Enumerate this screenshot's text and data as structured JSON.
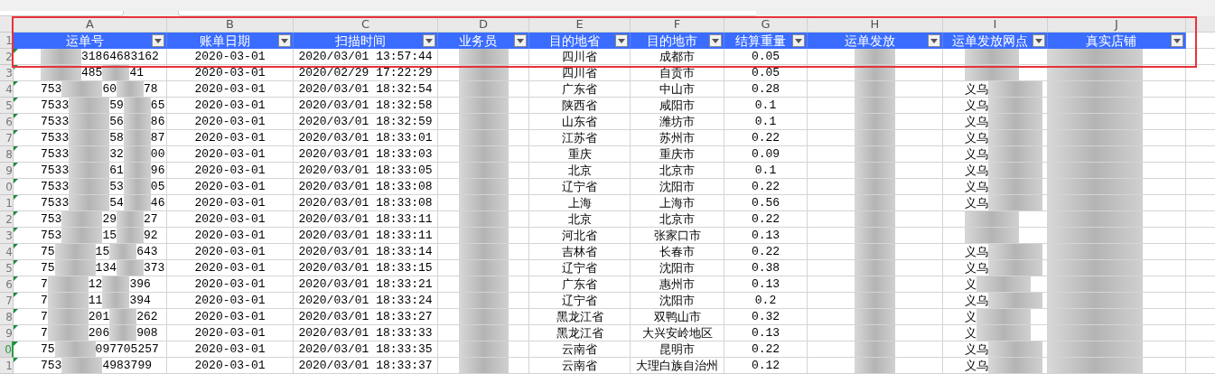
{
  "columns": [
    {
      "letter": "A",
      "title": "运单号"
    },
    {
      "letter": "B",
      "title": "账单日期"
    },
    {
      "letter": "C",
      "title": "扫描时间"
    },
    {
      "letter": "D",
      "title": "业务员"
    },
    {
      "letter": "E",
      "title": "目的地省"
    },
    {
      "letter": "F",
      "title": "目的地市"
    },
    {
      "letter": "G",
      "title": "结算重量"
    },
    {
      "letter": "H",
      "title": "运单发放"
    },
    {
      "letter": "I",
      "title": "运单发放网点"
    },
    {
      "letter": "J",
      "title": "真实店铺"
    }
  ],
  "header_row_number": "1",
  "rows": [
    {
      "number": "2",
      "selected": false,
      "waybill": {
        "tail": "31864683162"
      },
      "bill_date": "2020-03-01",
      "scan_time": "2020/03/01 13:57:44",
      "province": "四川省",
      "city": "成都市",
      "weight": "0.05"
    },
    {
      "number": "3",
      "selected": false,
      "waybill": {
        "mid": "485",
        "tail": "41"
      },
      "bill_date": "2020-03-01",
      "scan_time": "2020/02/29 17:22:29",
      "province": "四川省",
      "city": "自贡市",
      "weight": "0.05"
    },
    {
      "number": "4",
      "selected": false,
      "waybill": {
        "head": "753",
        "mid": "60",
        "tail": "78"
      },
      "bill_date": "2020-03-01",
      "scan_time": "2020/03/01 18:32:54",
      "province": "广东省",
      "city": "中山市",
      "weight": "0.28",
      "outlet": "义乌"
    },
    {
      "number": "5",
      "selected": false,
      "waybill": {
        "head": "7533",
        "mid": "59",
        "tail": "65"
      },
      "bill_date": "2020-03-01",
      "scan_time": "2020/03/01 18:32:58",
      "province": "陕西省",
      "city": "咸阳市",
      "weight": "0.1",
      "outlet": "义乌"
    },
    {
      "number": "6",
      "selected": false,
      "waybill": {
        "head": "7533",
        "mid": "56",
        "tail": "86"
      },
      "bill_date": "2020-03-01",
      "scan_time": "2020/03/01 18:32:59",
      "province": "山东省",
      "city": "潍坊市",
      "weight": "0.1",
      "outlet": "义乌"
    },
    {
      "number": "7",
      "selected": false,
      "waybill": {
        "head": "7533",
        "mid": "58",
        "tail": "87"
      },
      "bill_date": "2020-03-01",
      "scan_time": "2020/03/01 18:33:01",
      "province": "江苏省",
      "city": "苏州市",
      "weight": "0.22",
      "outlet": "义乌"
    },
    {
      "number": "8",
      "selected": false,
      "waybill": {
        "head": "7533",
        "mid": "32",
        "tail": "00"
      },
      "bill_date": "2020-03-01",
      "scan_time": "2020/03/01 18:33:03",
      "province": "重庆",
      "city": "重庆市",
      "weight": "0.09",
      "outlet": "义乌"
    },
    {
      "number": "9",
      "selected": false,
      "waybill": {
        "head": "7533",
        "mid": "61",
        "tail": "96"
      },
      "bill_date": "2020-03-01",
      "scan_time": "2020/03/01 18:33:05",
      "province": "北京",
      "city": "北京市",
      "weight": "0.1",
      "outlet": "义乌"
    },
    {
      "number": "0",
      "selected": false,
      "waybill": {
        "head": "7533",
        "mid": "53",
        "tail": "05"
      },
      "bill_date": "2020-03-01",
      "scan_time": "2020/03/01 18:33:08",
      "province": "辽宁省",
      "city": "沈阳市",
      "weight": "0.22",
      "outlet": "义乌"
    },
    {
      "number": "1",
      "selected": false,
      "waybill": {
        "head": "7533",
        "mid": "54",
        "tail": "46"
      },
      "bill_date": "2020-03-01",
      "scan_time": "2020/03/01 18:33:08",
      "province": "上海",
      "city": "上海市",
      "weight": "0.56",
      "outlet": "义乌"
    },
    {
      "number": "2",
      "selected": false,
      "waybill": {
        "head": "753",
        "mid": "29",
        "tail": "27"
      },
      "bill_date": "2020-03-01",
      "scan_time": "2020/03/01 18:33:11",
      "province": "北京",
      "city": "北京市",
      "weight": "0.22"
    },
    {
      "number": "3",
      "selected": false,
      "waybill": {
        "head": "753",
        "mid": "15",
        "tail": "92"
      },
      "bill_date": "2020-03-01",
      "scan_time": "2020/03/01 18:33:11",
      "province": "河北省",
      "city": "张家口市",
      "weight": "0.13"
    },
    {
      "number": "4",
      "selected": false,
      "waybill": {
        "head": "75",
        "mid": "15",
        "tail": "643"
      },
      "bill_date": "2020-03-01",
      "scan_time": "2020/03/01 18:33:14",
      "province": "吉林省",
      "city": "长春市",
      "weight": "0.22",
      "outlet": "义乌"
    },
    {
      "number": "5",
      "selected": false,
      "waybill": {
        "head": "75",
        "mid": "134",
        "tail": "373"
      },
      "bill_date": "2020-03-01",
      "scan_time": "2020/03/01 18:33:15",
      "province": "辽宁省",
      "city": "沈阳市",
      "weight": "0.38",
      "outlet": "义乌"
    },
    {
      "number": "6",
      "selected": false,
      "waybill": {
        "head": "7",
        "mid": "12",
        "tail": "396"
      },
      "bill_date": "2020-03-01",
      "scan_time": "2020/03/01 18:33:21",
      "province": "广东省",
      "city": "惠州市",
      "weight": "0.13",
      "outlet": "义"
    },
    {
      "number": "7",
      "selected": false,
      "waybill": {
        "head": "7",
        "mid": "11",
        "tail": "394"
      },
      "bill_date": "2020-03-01",
      "scan_time": "2020/03/01 18:33:24",
      "province": "辽宁省",
      "city": "沈阳市",
      "weight": "0.2",
      "outlet": "义乌"
    },
    {
      "number": "8",
      "selected": false,
      "waybill": {
        "head": "7",
        "mid": "201",
        "tail": "262"
      },
      "bill_date": "2020-03-01",
      "scan_time": "2020/03/01 18:33:27",
      "province": "黑龙江省",
      "city": "双鸭山市",
      "weight": "0.32",
      "outlet": "义"
    },
    {
      "number": "9",
      "selected": false,
      "waybill": {
        "head": "7",
        "mid": "206",
        "tail": "908"
      },
      "bill_date": "2020-03-01",
      "scan_time": "2020/03/01 18:33:33",
      "province": "黑龙江省",
      "city": "大兴安岭地区",
      "weight": "0.13",
      "outlet": "义"
    },
    {
      "number": "0",
      "selected": true,
      "waybill": {
        "head": "75",
        "tail": "097705257"
      },
      "bill_date": "2020-03-01",
      "scan_time": "2020/03/01 18:33:35",
      "province": "云南省",
      "city": "昆明市",
      "weight": "0.22",
      "outlet": "义乌"
    },
    {
      "number": "1",
      "selected": false,
      "waybill": {
        "head": "753",
        "tail": "4983799"
      },
      "bill_date": "2020-03-01",
      "scan_time": "2020/03/01 18:33:37",
      "province": "云南省",
      "city": "大理白族自治州",
      "weight": "0.12",
      "outlet": "义乌"
    }
  ]
}
